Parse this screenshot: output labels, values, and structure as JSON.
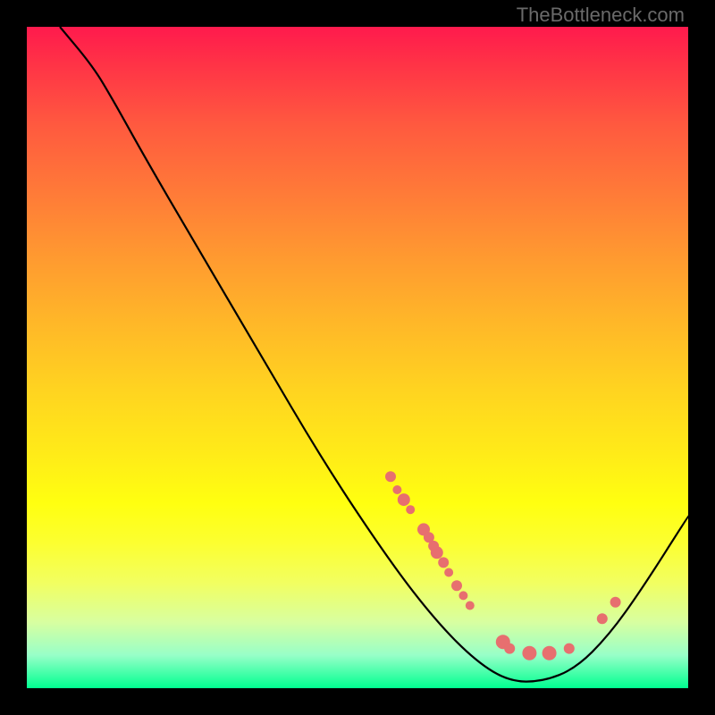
{
  "watermark": "TheBottleneck.com",
  "chart_data": {
    "type": "line",
    "title": "",
    "xlabel": "",
    "ylabel": "",
    "xlim": [
      0,
      100
    ],
    "ylim": [
      0,
      100
    ],
    "curve": [
      {
        "x": 5,
        "y": 100
      },
      {
        "x": 10,
        "y": 94
      },
      {
        "x": 13,
        "y": 89
      },
      {
        "x": 18,
        "y": 80
      },
      {
        "x": 25,
        "y": 68
      },
      {
        "x": 35,
        "y": 51
      },
      {
        "x": 45,
        "y": 34
      },
      {
        "x": 55,
        "y": 19
      },
      {
        "x": 62,
        "y": 10
      },
      {
        "x": 68,
        "y": 4
      },
      {
        "x": 73,
        "y": 1
      },
      {
        "x": 78,
        "y": 1
      },
      {
        "x": 83,
        "y": 3
      },
      {
        "x": 88,
        "y": 8
      },
      {
        "x": 93,
        "y": 15
      },
      {
        "x": 100,
        "y": 26
      }
    ],
    "scatter": [
      {
        "x": 55,
        "y": 32,
        "r": 6
      },
      {
        "x": 56,
        "y": 30,
        "r": 5
      },
      {
        "x": 57,
        "y": 28.5,
        "r": 7
      },
      {
        "x": 58,
        "y": 27,
        "r": 5
      },
      {
        "x": 60,
        "y": 24,
        "r": 7
      },
      {
        "x": 60.8,
        "y": 22.8,
        "r": 6
      },
      {
        "x": 61.5,
        "y": 21.5,
        "r": 6
      },
      {
        "x": 62,
        "y": 20.5,
        "r": 7
      },
      {
        "x": 63,
        "y": 19,
        "r": 6
      },
      {
        "x": 63.8,
        "y": 17.5,
        "r": 5
      },
      {
        "x": 65,
        "y": 15.5,
        "r": 6
      },
      {
        "x": 66,
        "y": 14,
        "r": 5
      },
      {
        "x": 67,
        "y": 12.5,
        "r": 5
      },
      {
        "x": 72,
        "y": 7,
        "r": 8
      },
      {
        "x": 73,
        "y": 6,
        "r": 6
      },
      {
        "x": 76,
        "y": 5.3,
        "r": 8
      },
      {
        "x": 79,
        "y": 5.3,
        "r": 8
      },
      {
        "x": 82,
        "y": 6,
        "r": 6
      },
      {
        "x": 87,
        "y": 10.5,
        "r": 6
      },
      {
        "x": 89,
        "y": 13,
        "r": 6
      }
    ],
    "scatter_color": "#e76f6f",
    "curve_color": "#000000"
  }
}
